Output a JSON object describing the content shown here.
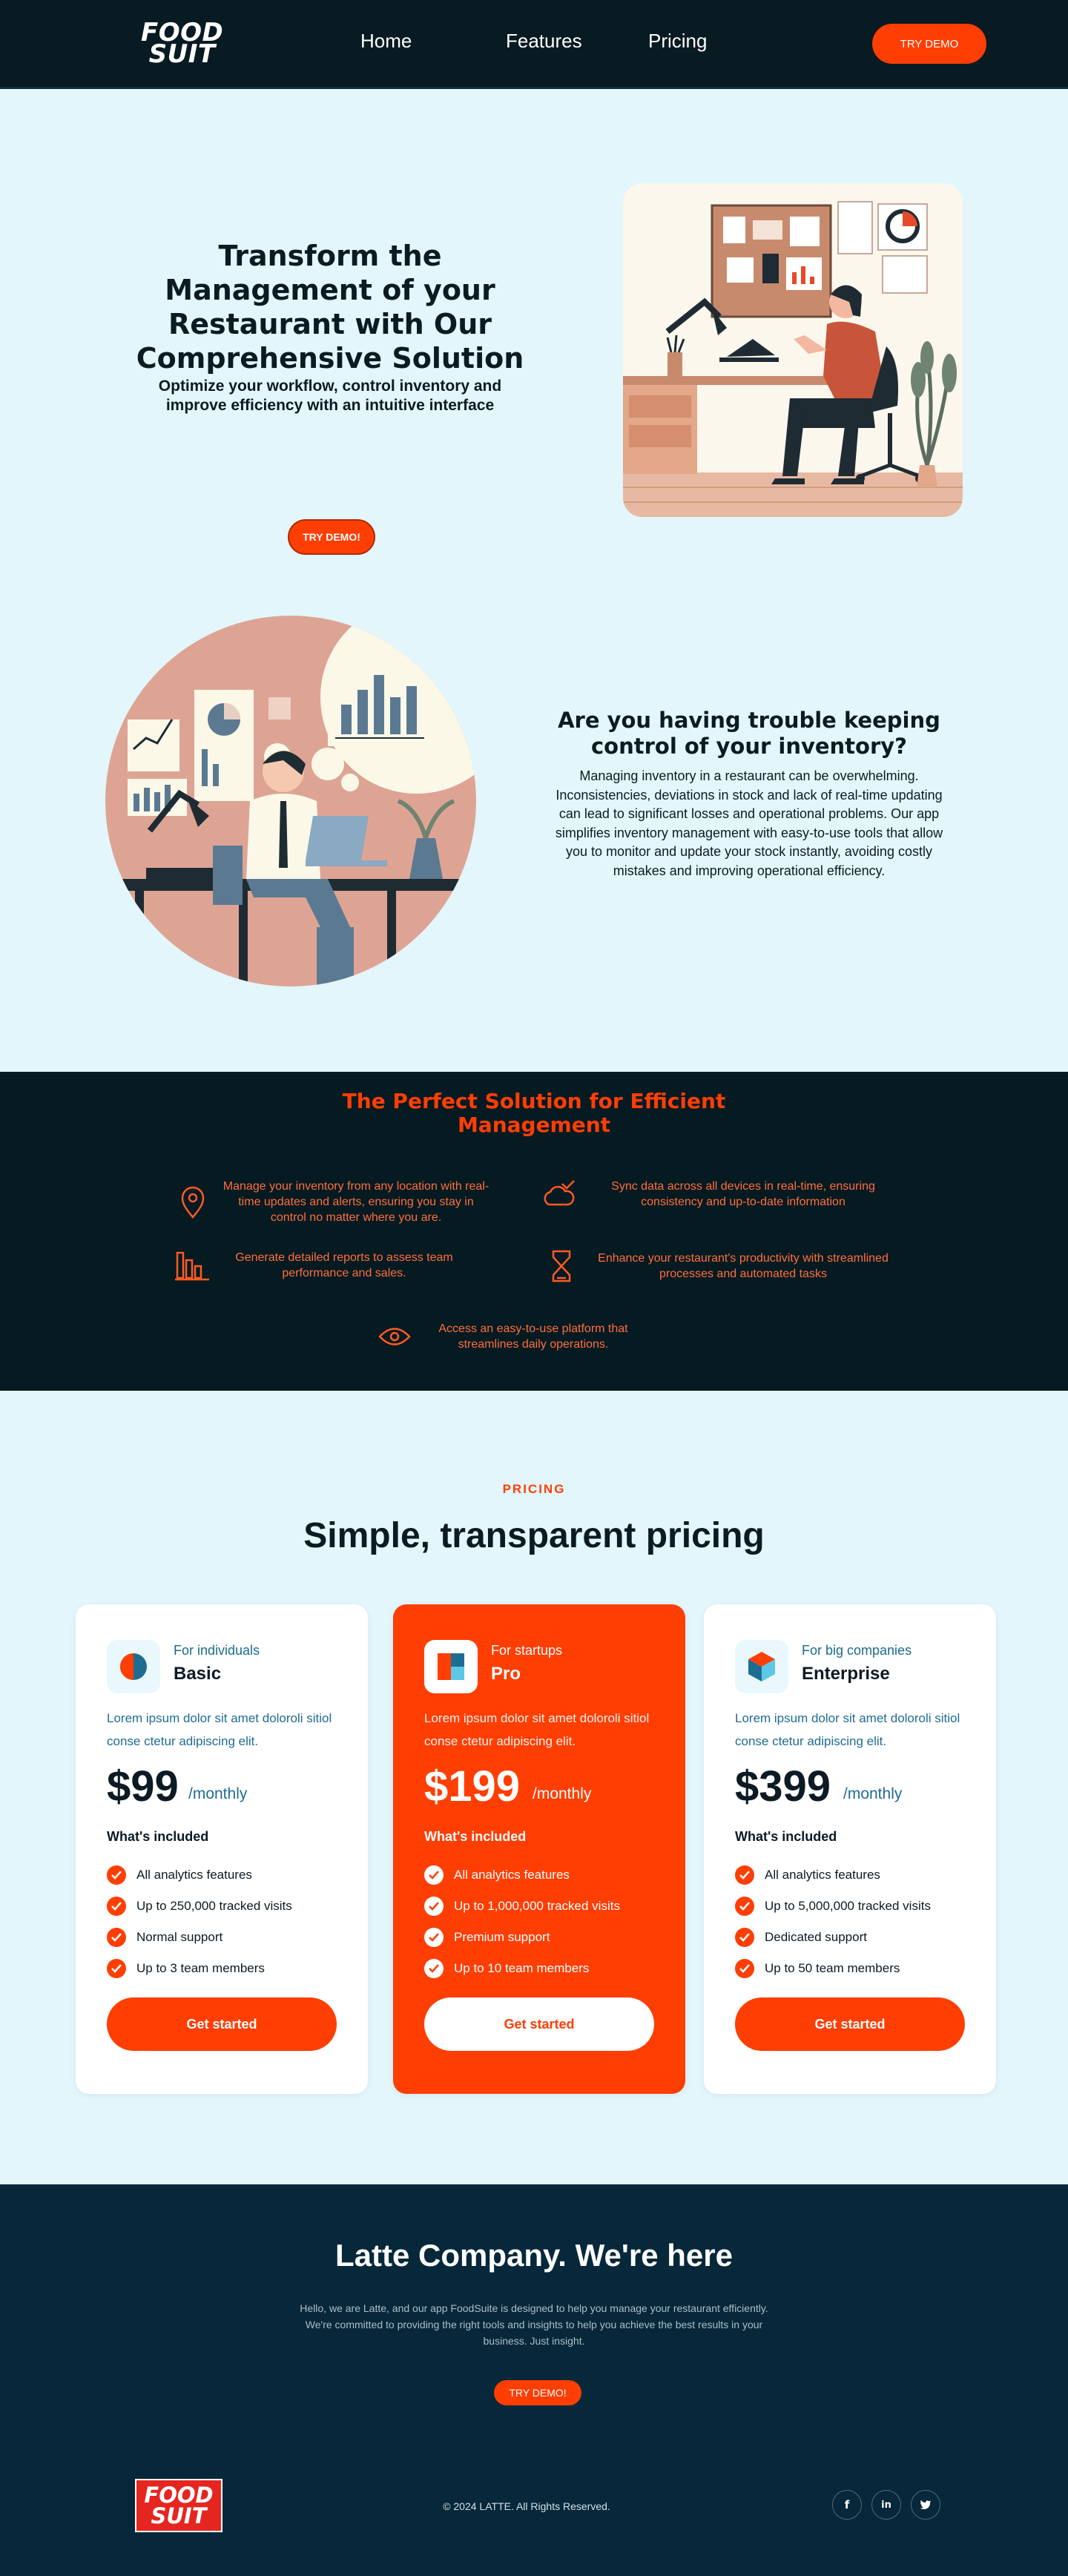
{
  "nav": {
    "logo_line1": "FOOD",
    "logo_line2": "SUIT",
    "links": [
      "Home",
      "Features",
      "Pricing"
    ],
    "cta": "TRY DEMO"
  },
  "hero": {
    "title": "Transform the Management of your Restaurant with Our Comprehensive Solution",
    "subtitle": "Optimize your workflow, control inventory and improve efficiency with an intuitive interface",
    "cta": "TRY DEMO!"
  },
  "problem": {
    "title": "Are you having trouble keeping control of your inventory?",
    "text": "Managing inventory in a restaurant can be overwhelming. Inconsistencies, deviations in stock and lack of real-time updating can lead to significant losses and operational problems. Our app simplifies inventory management with easy-to-use tools that allow you to monitor and update your stock instantly, avoiding costly mistakes and improving operational efficiency."
  },
  "features": {
    "title": "The Perfect Solution for Efficient Management",
    "items": [
      {
        "icon": "location-pin-icon",
        "text": "Manage your inventory from any location with real-time updates and alerts, ensuring you stay in control no matter where you are."
      },
      {
        "icon": "cloud-sync-icon",
        "text": "Sync data across all devices in real-time, ensuring consistency and up-to-date information"
      },
      {
        "icon": "bar-chart-icon",
        "text": "Generate detailed reports to assess team performance and sales."
      },
      {
        "icon": "hourglass-icon",
        "text": "Enhance your restaurant's productivity with streamlined processes and automated tasks"
      },
      {
        "icon": "eye-icon",
        "text": "Access an easy-to-use platform that streamlines daily operations."
      }
    ]
  },
  "pricing": {
    "kicker": "PRICING",
    "title": "Simple, transparent pricing",
    "plans": [
      {
        "for": "For individuals",
        "name": "Basic",
        "desc": "Lorem ipsum dolor sit amet doloroli sitiol conse ctetur adipiscing elit.",
        "price": "$99",
        "period": "/monthly",
        "included": "What's included",
        "features": [
          "All analytics features",
          "Up to 250,000 tracked visits",
          "Normal support",
          "Up to 3 team members"
        ],
        "cta": "Get started"
      },
      {
        "for": "For startups",
        "name": "Pro",
        "desc": "Lorem ipsum dolor sit amet doloroli sitiol conse ctetur adipiscing elit.",
        "price": "$199",
        "period": "/monthly",
        "included": "What's included",
        "features": [
          "All analytics features",
          "Up to 1,000,000 tracked visits",
          "Premium support",
          "Up to 10 team members"
        ],
        "cta": "Get started"
      },
      {
        "for": "For big companies",
        "name": "Enterprise",
        "desc": "Lorem ipsum dolor sit amet doloroli sitiol conse ctetur adipiscing elit.",
        "price": "$399",
        "period": "/monthly",
        "included": "What's included",
        "features": [
          "All analytics features",
          "Up to 5,000,000 tracked visits",
          "Dedicated support",
          "Up to 50 team members"
        ],
        "cta": "Get started"
      }
    ]
  },
  "footer": {
    "title": "Latte Company. We're here",
    "text": "Hello, we are Latte, and our app FoodSuite is designed to help you manage your restaurant efficiently. We're committed to providing the right tools and insights to help you achieve the best results in your business. Just insight.",
    "cta": "TRY DEMO!",
    "logo_line1": "FOOD",
    "logo_line2": "SUIT",
    "copyright": "© 2024 LATTE. All Rights Reserved.",
    "social": [
      "f",
      "in",
      "t"
    ]
  },
  "colors": {
    "accent": "#ff3e04",
    "dark": "#081a22",
    "footer": "#06283a",
    "background": "#e2f6fc"
  }
}
